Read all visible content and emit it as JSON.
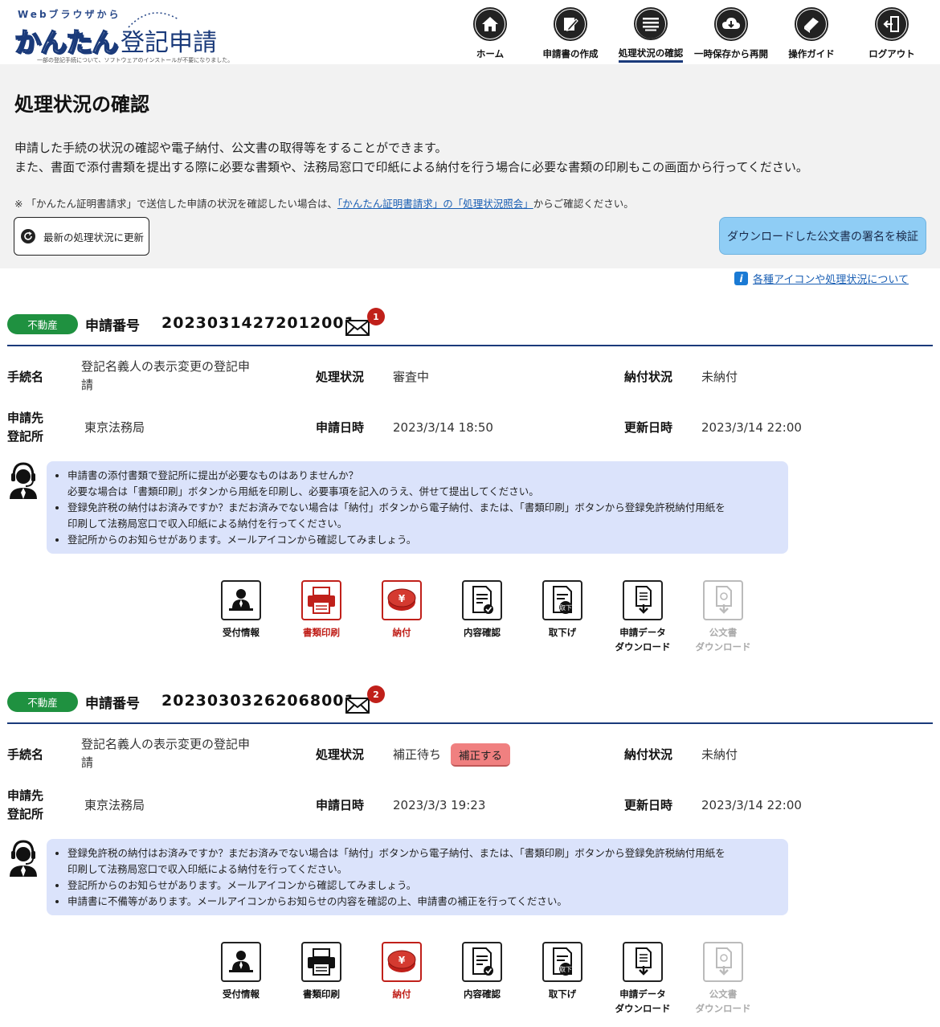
{
  "header": {
    "logo_sub": "Webブラウザから",
    "logo_kantan": "かんたん",
    "logo_main": "登記申請",
    "logo_tiny": "一部の登記手続について、ソフトウェアのインストールが不要になりました。",
    "nav": [
      {
        "label": "ホーム",
        "icon": "home-icon"
      },
      {
        "label": "申請書の作成",
        "icon": "edit-icon"
      },
      {
        "label": "処理状況の確認",
        "icon": "list-icon",
        "active": true
      },
      {
        "label": "一時保存から再開",
        "icon": "cloud-download-icon"
      },
      {
        "label": "操作ガイド",
        "icon": "book-icon"
      },
      {
        "label": "ログアウト",
        "icon": "logout-icon"
      }
    ]
  },
  "intro": {
    "title": "処理状況の確認",
    "line1": "申請した手続の状況の確認や電子納付、公文書の取得等をすることができます。",
    "line2": "また、書面で添付書類を提出する際に必要な書類や、法務局窓口で印紙による納付を行う場合に必要な書類の印刷もこの画面から行ってください。",
    "note_prefix": "※ 「かんたん証明書請求」で送信した申請の状況を確認したい場合は、",
    "note_link": "「かんたん証明書請求」の「処理状況照会」",
    "note_suffix": "からご確認ください。",
    "refresh_button": "最新の処理状況に更新",
    "verify_button": "ダウンロードした公文書の署名を検証",
    "help_link": "各種アイコンや処理状況について"
  },
  "labels": {
    "app_no": "申請番号",
    "procedure": "手続名",
    "status": "処理状況",
    "payment": "納付状況",
    "registry_line1": "申請先",
    "registry_line2": "登記所",
    "applied_at": "申請日時",
    "updated_at": "更新日時"
  },
  "applications": [
    {
      "badge": "不動産",
      "number": "20230314272012001",
      "mail_count": "1",
      "procedure_line1": "登記名義人の表示変更の登記申",
      "procedure_line2": "請",
      "status": "審査中",
      "payment": "未納付",
      "registry": "東京法務局",
      "applied_at": "2023/3/14 18:50",
      "updated_at": "2023/3/14 22:00",
      "advice": [
        "申請書の添付書類で登記所に提出が必要なものはありませんか？",
        "必要な場合は「書類印刷」ボタンから用紙を印刷し、必要事項を記入のうえ、併せて提出してください。",
        "登録免許税の納付はお済みですか？まだお済みでない場合は「納付」ボタンから電子納付、または、「書類印刷」ボタンから登録免許税納付用紙を",
        "印刷して法務局窓口で収入印紙による納付を行ってください。",
        "登記所からのお知らせがあります。メールアイコンから確認してみましょう。"
      ],
      "actions": [
        {
          "label": "受付情報",
          "style": "normal"
        },
        {
          "label": "書類印刷",
          "style": "red"
        },
        {
          "label": "納付",
          "style": "red"
        },
        {
          "label": "内容確認",
          "style": "normal"
        },
        {
          "label": "取下げ",
          "style": "normal"
        },
        {
          "label": "申請データ",
          "label2": "ダウンロード",
          "style": "normal"
        },
        {
          "label": "公文書",
          "label2": "ダウンロード",
          "style": "gray"
        }
      ]
    },
    {
      "badge": "不動産",
      "number": "20230303262068001",
      "mail_count": "2",
      "procedure_line1": "登記名義人の表示変更の登記申",
      "procedure_line2": "請",
      "status": "補正待ち",
      "hosei_button": "補正する",
      "payment": "未納付",
      "registry": "東京法務局",
      "applied_at": "2023/3/3 19:23",
      "updated_at": "2023/3/14 22:00",
      "advice": [
        "登録免許税の納付はお済みですか？まだお済みでない場合は「納付」ボタンから電子納付、または、「書類印刷」ボタンから登録免許税納付用紙を",
        "印刷して法務局窓口で収入印紙による納付を行ってください。",
        "登記所からのお知らせがあります。メールアイコンから確認してみましょう。",
        "申請書に不備等があります。メールアイコンからお知らせの内容を確認の上、申請書の補正を行ってください。"
      ],
      "actions": [
        {
          "label": "受付情報",
          "style": "normal"
        },
        {
          "label": "書類印刷",
          "style": "normal"
        },
        {
          "label": "納付",
          "style": "red"
        },
        {
          "label": "内容確認",
          "style": "normal"
        },
        {
          "label": "取下げ",
          "style": "normal"
        },
        {
          "label": "申請データ",
          "label2": "ダウンロード",
          "style": "normal"
        },
        {
          "label": "公文書",
          "label2": "ダウンロード",
          "style": "gray"
        }
      ]
    }
  ],
  "colors": {
    "accent": "#1a3a7a",
    "badge": "#1f9140",
    "red": "#c0201a",
    "advice_bg": "#dbe3fb",
    "verify_bg": "#8fcdf5"
  }
}
